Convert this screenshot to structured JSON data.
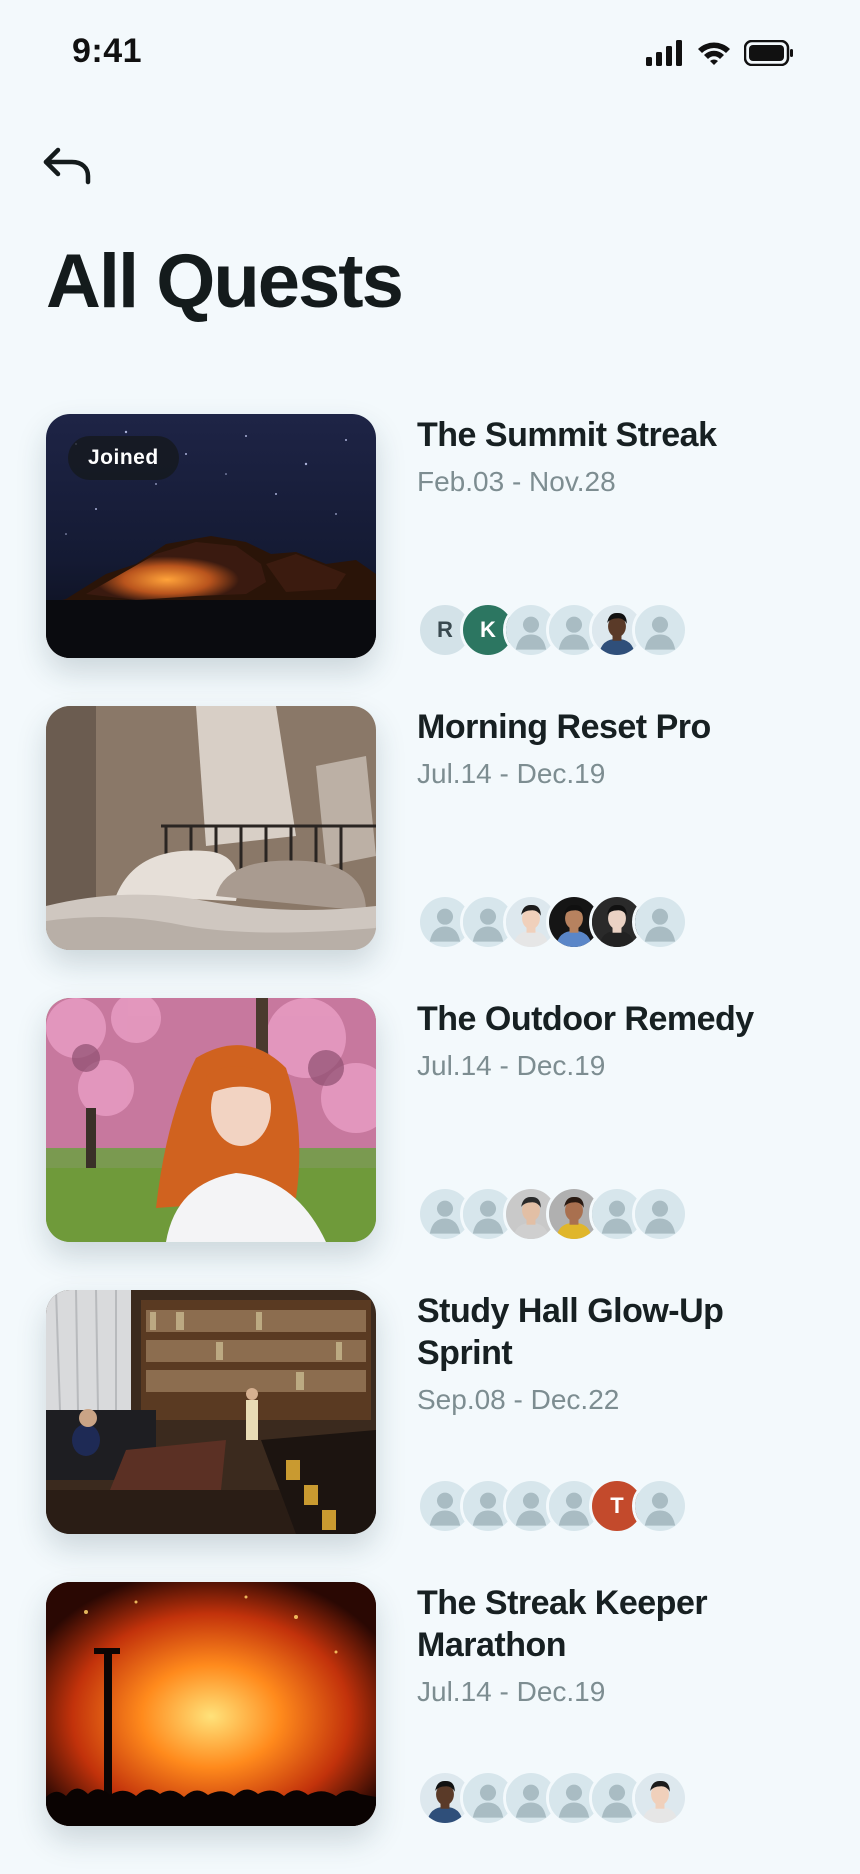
{
  "status_bar": {
    "time": "9:41"
  },
  "page": {
    "title": "All Quests"
  },
  "colors": {
    "background": "#f3f9fc",
    "title_text": "#172022",
    "date_text": "#7d8d91",
    "avatar_placeholder": "#d7e6ec"
  },
  "quests": [
    {
      "title": "The Summit Streak",
      "dates": "Feb.03 - Nov.28",
      "badge": "Joined",
      "image": "night-sky-rocks",
      "avatars": [
        {
          "type": "letter",
          "letter": "R",
          "bg": "#d3e2e8",
          "fg": "#3a4a50"
        },
        {
          "type": "letter",
          "letter": "K",
          "bg": "#2c7661",
          "fg": "#ffffff"
        },
        {
          "type": "placeholder"
        },
        {
          "type": "placeholder"
        },
        {
          "type": "photo",
          "skin": "#5a3a28",
          "hair": "#111111",
          "shirt": "#2f4f7a"
        },
        {
          "type": "placeholder"
        }
      ]
    },
    {
      "title": "Morning Reset Pro",
      "dates": "Jul.14 - Dec.19",
      "badge": "",
      "image": "bedroom",
      "avatars": [
        {
          "type": "placeholder"
        },
        {
          "type": "placeholder"
        },
        {
          "type": "photo",
          "skin": "#f0d0bb",
          "hair": "#1c1c1c",
          "shirt": "#e6e6e6"
        },
        {
          "type": "photo",
          "skin": "#b7825f",
          "hair": "#101010",
          "shirt": "#5a86c8",
          "bg": "#151515"
        },
        {
          "type": "photo",
          "skin": "#ead2c4",
          "hair": "#111111",
          "shirt": "#222222",
          "bg": "#2a2a2a"
        },
        {
          "type": "placeholder"
        }
      ]
    },
    {
      "title": "The Outdoor Remedy",
      "dates": "Jul.14 - Dec.19",
      "badge": "",
      "image": "woman-blossoms",
      "avatars": [
        {
          "type": "placeholder"
        },
        {
          "type": "placeholder"
        },
        {
          "type": "photo",
          "skin": "#e2bfa5",
          "hair": "#2a2a2a",
          "shirt": "#cfcfcf",
          "bg": "#c9c9c9"
        },
        {
          "type": "photo",
          "skin": "#a9704f",
          "hair": "#2a1a12",
          "shirt": "#e0b62a",
          "bg": "#b0b0b0"
        },
        {
          "type": "placeholder"
        },
        {
          "type": "placeholder"
        }
      ]
    },
    {
      "title": "Study Hall Glow-Up Sprint",
      "dates": "Sep.08 - Dec.22",
      "badge": "",
      "image": "library",
      "avatars": [
        {
          "type": "placeholder"
        },
        {
          "type": "placeholder"
        },
        {
          "type": "placeholder"
        },
        {
          "type": "placeholder"
        },
        {
          "type": "letter",
          "letter": "T",
          "bg": "#c34a2c",
          "fg": "#ffffff"
        },
        {
          "type": "placeholder"
        }
      ]
    },
    {
      "title": "The Streak Keeper Marathon",
      "dates": "Jul.14 - Dec.19",
      "badge": "",
      "image": "bonfire",
      "avatars": [
        {
          "type": "photo",
          "skin": "#5a3a28",
          "hair": "#111111",
          "shirt": "#2f4f7a"
        },
        {
          "type": "placeholder"
        },
        {
          "type": "placeholder"
        },
        {
          "type": "placeholder"
        },
        {
          "type": "placeholder"
        },
        {
          "type": "photo",
          "skin": "#f0d0bb",
          "hair": "#1c1c1c",
          "shirt": "#e6e6e6"
        }
      ]
    }
  ]
}
